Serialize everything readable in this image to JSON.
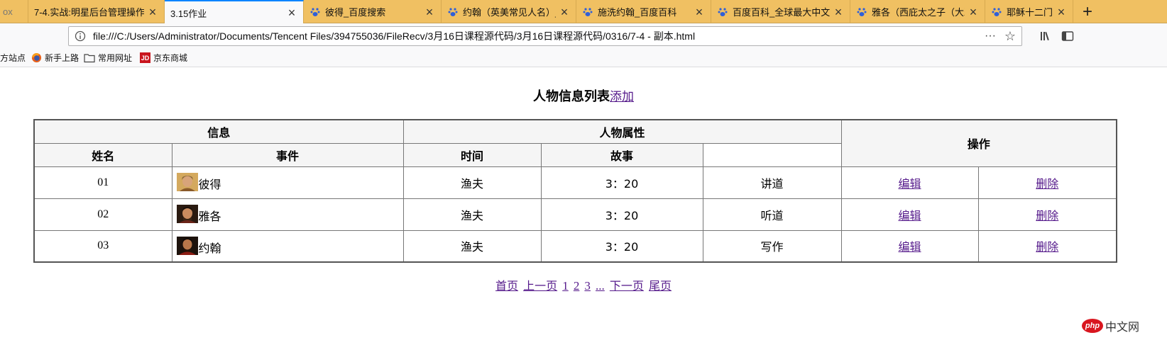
{
  "browser": {
    "tabs": [
      {
        "title": "7-4.实战:明星后台管理操作",
        "icon": "page-icon",
        "active": false
      },
      {
        "title": "3.15作业",
        "icon": "none",
        "active": true
      },
      {
        "title": "彼得_百度搜索",
        "icon": "baidu-paw-icon",
        "active": false
      },
      {
        "title": "约翰（英美常见人名）_百",
        "icon": "baidu-paw-icon",
        "active": false
      },
      {
        "title": "施洗约翰_百度百科",
        "icon": "baidu-paw-icon",
        "active": false
      },
      {
        "title": "百度百科_全球最大中文百",
        "icon": "baidu-paw-icon",
        "active": false
      },
      {
        "title": "雅各（西庇太之子（大雅",
        "icon": "baidu-paw-icon",
        "active": false
      },
      {
        "title": "耶稣十二门徒_百度百科",
        "icon": "baidu-paw-icon",
        "active": false
      }
    ],
    "tab_close": "×",
    "new_tab": "+",
    "partial_tab_left": "ox",
    "url": "file:///C:/Users/Administrator/Documents/Tencent Files/394755036/FileRecv/3月16日课程源代码/3月16日课程源代码/0316/7-4 - 副本.html",
    "more_glyph": "···",
    "star_glyph": "☆"
  },
  "bookmarks": [
    {
      "label": "方站点",
      "icon": "none"
    },
    {
      "label": "新手上路",
      "icon": "firefox-icon"
    },
    {
      "label": "常用网址",
      "icon": "folder-icon"
    },
    {
      "label": "京东商城",
      "icon": "jd-icon"
    }
  ],
  "page": {
    "title": "人物信息列表",
    "add_link": "添加",
    "headers": {
      "group_info": "信息",
      "group_attrs": "人物属性",
      "group_ops": "操作",
      "name": "姓名",
      "event": "事件",
      "time": "时间",
      "story": "故事"
    },
    "rows": [
      {
        "id": "01",
        "name": "彼得",
        "job": "渔夫",
        "time": "3：20",
        "story": "讲道",
        "edit": "编辑",
        "delete": "删除"
      },
      {
        "id": "02",
        "name": "雅各",
        "job": "渔夫",
        "time": "3：20",
        "story": "听道",
        "edit": "编辑",
        "delete": "删除"
      },
      {
        "id": "03",
        "name": "约翰",
        "job": "渔夫",
        "time": "3：20",
        "story": "写作",
        "edit": "编辑",
        "delete": "删除"
      }
    ],
    "pager": {
      "first": "首页",
      "prev": "上一页",
      "pages": [
        "1",
        "2",
        "3"
      ],
      "ellipsis": "...",
      "next": "下一页",
      "last": "尾页"
    }
  },
  "watermark": {
    "logo": "php",
    "text": "中文网"
  }
}
